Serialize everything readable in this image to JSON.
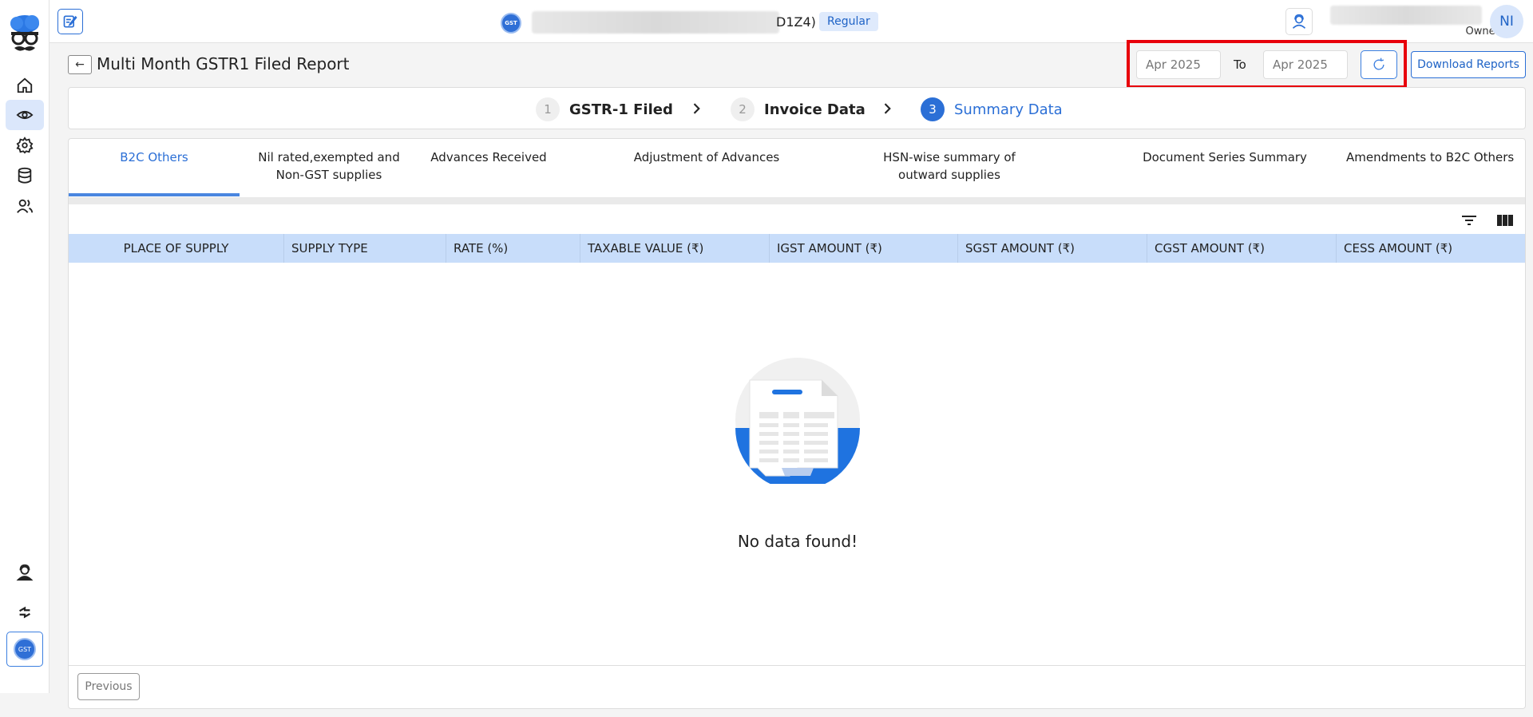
{
  "header": {
    "gst_logo_text": "GST",
    "gstin_tail": "D1Z4)",
    "taxpayer_type": "Regular",
    "user_role": "Owner",
    "avatar_initials": "NI"
  },
  "page": {
    "title": "Multi Month GSTR1 Filed Report",
    "from_period": "Apr  2025",
    "to_label": "To",
    "to_period": "Apr  2025",
    "download_label": "Download Reports"
  },
  "stepper": {
    "steps": [
      {
        "num": "1",
        "label": "GSTR-1 Filed"
      },
      {
        "num": "2",
        "label": "Invoice Data"
      },
      {
        "num": "3",
        "label": "Summary Data"
      }
    ],
    "active_step": 3
  },
  "tabs": [
    {
      "label": "B2C Others"
    },
    {
      "label": "Nil rated,exempted and Non-GST supplies"
    },
    {
      "label": "Advances Received"
    },
    {
      "label": "Adjustment of Advances"
    },
    {
      "label": "HSN-wise summary of outward supplies"
    },
    {
      "label": "Document Series Summary"
    },
    {
      "label": "Amendments to B2C Others"
    }
  ],
  "table": {
    "columns": [
      "PLACE OF SUPPLY",
      "SUPPLY TYPE",
      "RATE (%)",
      "TAXABLE VALUE (₹)",
      "IGST AMOUNT (₹)",
      "SGST AMOUNT (₹)",
      "CGST AMOUNT (₹)",
      "CESS AMOUNT (₹)"
    ],
    "empty_message": "No data found!"
  },
  "pagination": {
    "previous_label": "Previous"
  },
  "colors": {
    "accent": "#2b6fd6",
    "table_header": "#c8ddfa",
    "highlight": "#e8000b"
  },
  "icons": {
    "sidebar": [
      "home-icon",
      "eye-icon",
      "gear-icon",
      "database-icon",
      "users-icon",
      "support-agent-icon",
      "sync-icon",
      "gst-badge-icon"
    ],
    "toolbar": [
      "filter-icon",
      "columns-icon"
    ]
  }
}
